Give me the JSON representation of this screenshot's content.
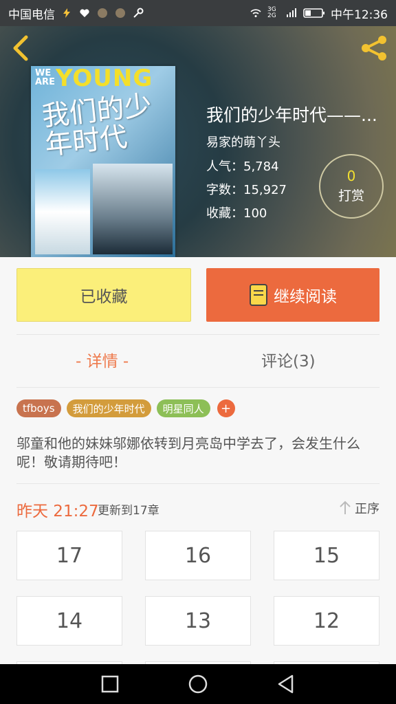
{
  "status_bar": {
    "carrier": "中国电信",
    "network_label": "3G 2G",
    "time": "中午12:36"
  },
  "book": {
    "title": "我们的少年时代——...",
    "author": "易家的萌丫头",
    "popularity_label": "人气：",
    "popularity_value": "5,784",
    "words_label": "字数：",
    "words_value": "15,927",
    "favorites_label": "收藏：",
    "favorites_value": "100",
    "cover": {
      "we_are": "WE ARE",
      "young": "YOUNG",
      "title": "我们的少年时代"
    }
  },
  "reward": {
    "count": "0",
    "label": "打赏"
  },
  "actions": {
    "favorited_label": "已收藏",
    "continue_label": "继续阅读"
  },
  "tabs": {
    "detail": "- 详情 -",
    "comments": "评论(3)"
  },
  "tags": [
    {
      "label": "tfboys",
      "color": "#c8734f"
    },
    {
      "label": "我们的少年时代",
      "color": "#d39c3c"
    },
    {
      "label": "明星同人",
      "color": "#8dbf57"
    }
  ],
  "tag_add": "+",
  "description": "邬童和他的妹妹邬娜依转到月亮岛中学去了，会发生什么呢！敬请期待吧！",
  "update": {
    "time": "昨天 21:27",
    "text": "更新到17章",
    "order_label": "正序"
  },
  "chapters": [
    "17",
    "16",
    "15",
    "14",
    "13",
    "12"
  ],
  "colors": {
    "accent": "#ec6a3e",
    "favorite_bg": "#fbef7a",
    "reward_count": "#f3e030"
  }
}
